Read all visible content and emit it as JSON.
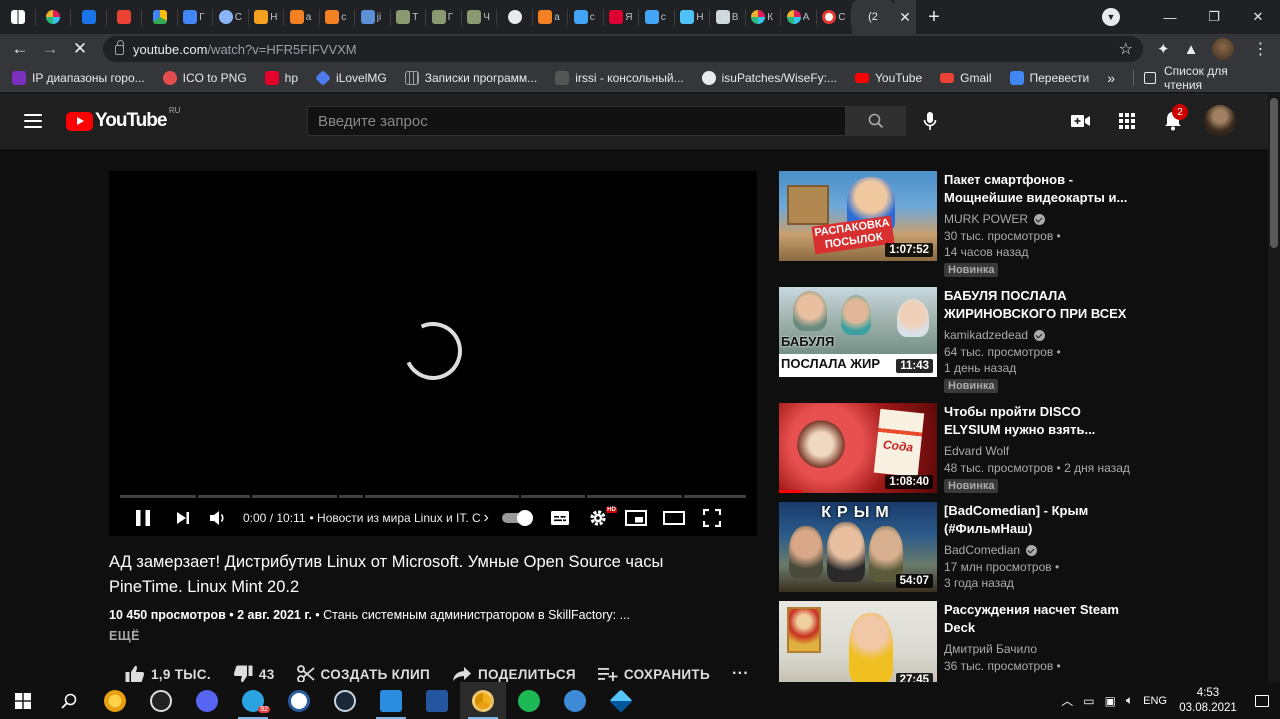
{
  "browser": {
    "tab_letters": [
      "",
      "",
      "",
      "",
      "",
      "Г",
      "С",
      "Н",
      "а",
      "с",
      "ji",
      "Т",
      "Г",
      "Ч",
      "",
      "а",
      "с",
      "Я",
      "с",
      "Н",
      "В",
      "К",
      "А",
      "С"
    ],
    "active_tab_label": "(2",
    "url_domain": "youtube.com",
    "url_path": "/watch?v=HFR5FIFVVXM",
    "bookmarks": [
      {
        "label": "IP диапазоны горо...",
        "color": "#7b2fbe"
      },
      {
        "label": "ICO to PNG",
        "color": "#e44d4d"
      },
      {
        "label": "hp",
        "color": "#e4002b"
      },
      {
        "label": "iLovelMG",
        "color": "#4b7bec"
      },
      {
        "label": "Записки программ...",
        "color": "#9aa0a6"
      },
      {
        "label": "irssi - консольный...",
        "color": "#555555"
      },
      {
        "label": "isuPatches/WiseFy:...",
        "color": "#e8eaed"
      },
      {
        "label": "YouTube",
        "color": "#ff0000"
      },
      {
        "label": "Gmail",
        "color": "#ea4335"
      },
      {
        "label": "Перевести",
        "color": "#4285f4"
      }
    ],
    "bookmarks_more": "»",
    "reading_list": "Список для чтения"
  },
  "youtube": {
    "logo_text": "YouTube",
    "logo_country": "RU",
    "search_placeholder": "Введите запрос",
    "notifications_count": "2",
    "player": {
      "time": "0:00 / 10:11",
      "chapter": "• Новости из мира Linux и IT. С...",
      "chapter_arrow": "›"
    },
    "video": {
      "title": "АД замерзает! Дистрибутив Linux от Microsoft. Умные Open Source часы PineTime. Linux Mint 20.2",
      "views_date": "10 450 просмотров • 2 авг. 2021 г.",
      "description": " • Стань системным администратором в SkillFactory: ...",
      "more_label": "ЕЩЁ",
      "likes": "1,9 ТЫС.",
      "dislikes": "43",
      "clip_label": "СОЗДАТЬ КЛИП",
      "share_label": "ПОДЕЛИТЬСЯ",
      "save_label": "СОХРАНИТЬ",
      "more_actions": "···"
    },
    "recommendations": [
      {
        "title": "Пакет смартфонов - Мощнейшие видеокарты и...",
        "channel": "MURK POWER",
        "verified": true,
        "views": "30 тыс. просмотров •",
        "age": "14 часов назад",
        "badge": "Новинка",
        "duration": "1:07:52",
        "thumb_text": "РАСПАКОВКА ПОСЫЛОК"
      },
      {
        "title": "БАБУЛЯ ПОСЛАЛА ЖИРИНОВСКОГО ПРИ ВСЕХ",
        "channel": "kamikadzedead",
        "verified": true,
        "views": "64 тыс. просмотров •",
        "age": "1 день назад",
        "badge": "Новинка",
        "duration": "11:43",
        "thumb_text": "БАБУЛЯ ПОСЛАЛА ЖИР"
      },
      {
        "title": "Чтобы пройти DISCO ELYSIUM нужно взять...",
        "channel": "Edvard Wolf",
        "verified": false,
        "views": "48 тыс. просмотров • 2 дня назад",
        "age": "",
        "badge": "Новинка",
        "duration": "1:08:40",
        "thumb_text": "Сода"
      },
      {
        "title": "[BadComedian] - Крым (#ФильмНаш)",
        "channel": "BadComedian",
        "verified": true,
        "views": "17 млн просмотров •",
        "age": "3 года назад",
        "badge": "",
        "duration": "54:07",
        "thumb_text": "КРЫМ"
      },
      {
        "title": "Рассуждения насчет Steam Deck",
        "channel": "Дмитрий Бачило",
        "verified": false,
        "views": "36 тыс. просмотров •",
        "age": "",
        "badge": "",
        "duration": "27:45",
        "thumb_text": ""
      }
    ]
  },
  "taskbar": {
    "language": "ENG",
    "time": "4:53",
    "date": "03.08.2021",
    "telegram_badge": "92"
  },
  "colors": {
    "yt_red": "#ff0000",
    "page_bg": "#181818",
    "header_bg": "#202020",
    "chrome_dark": "#202124",
    "chrome_light": "#35363a"
  }
}
